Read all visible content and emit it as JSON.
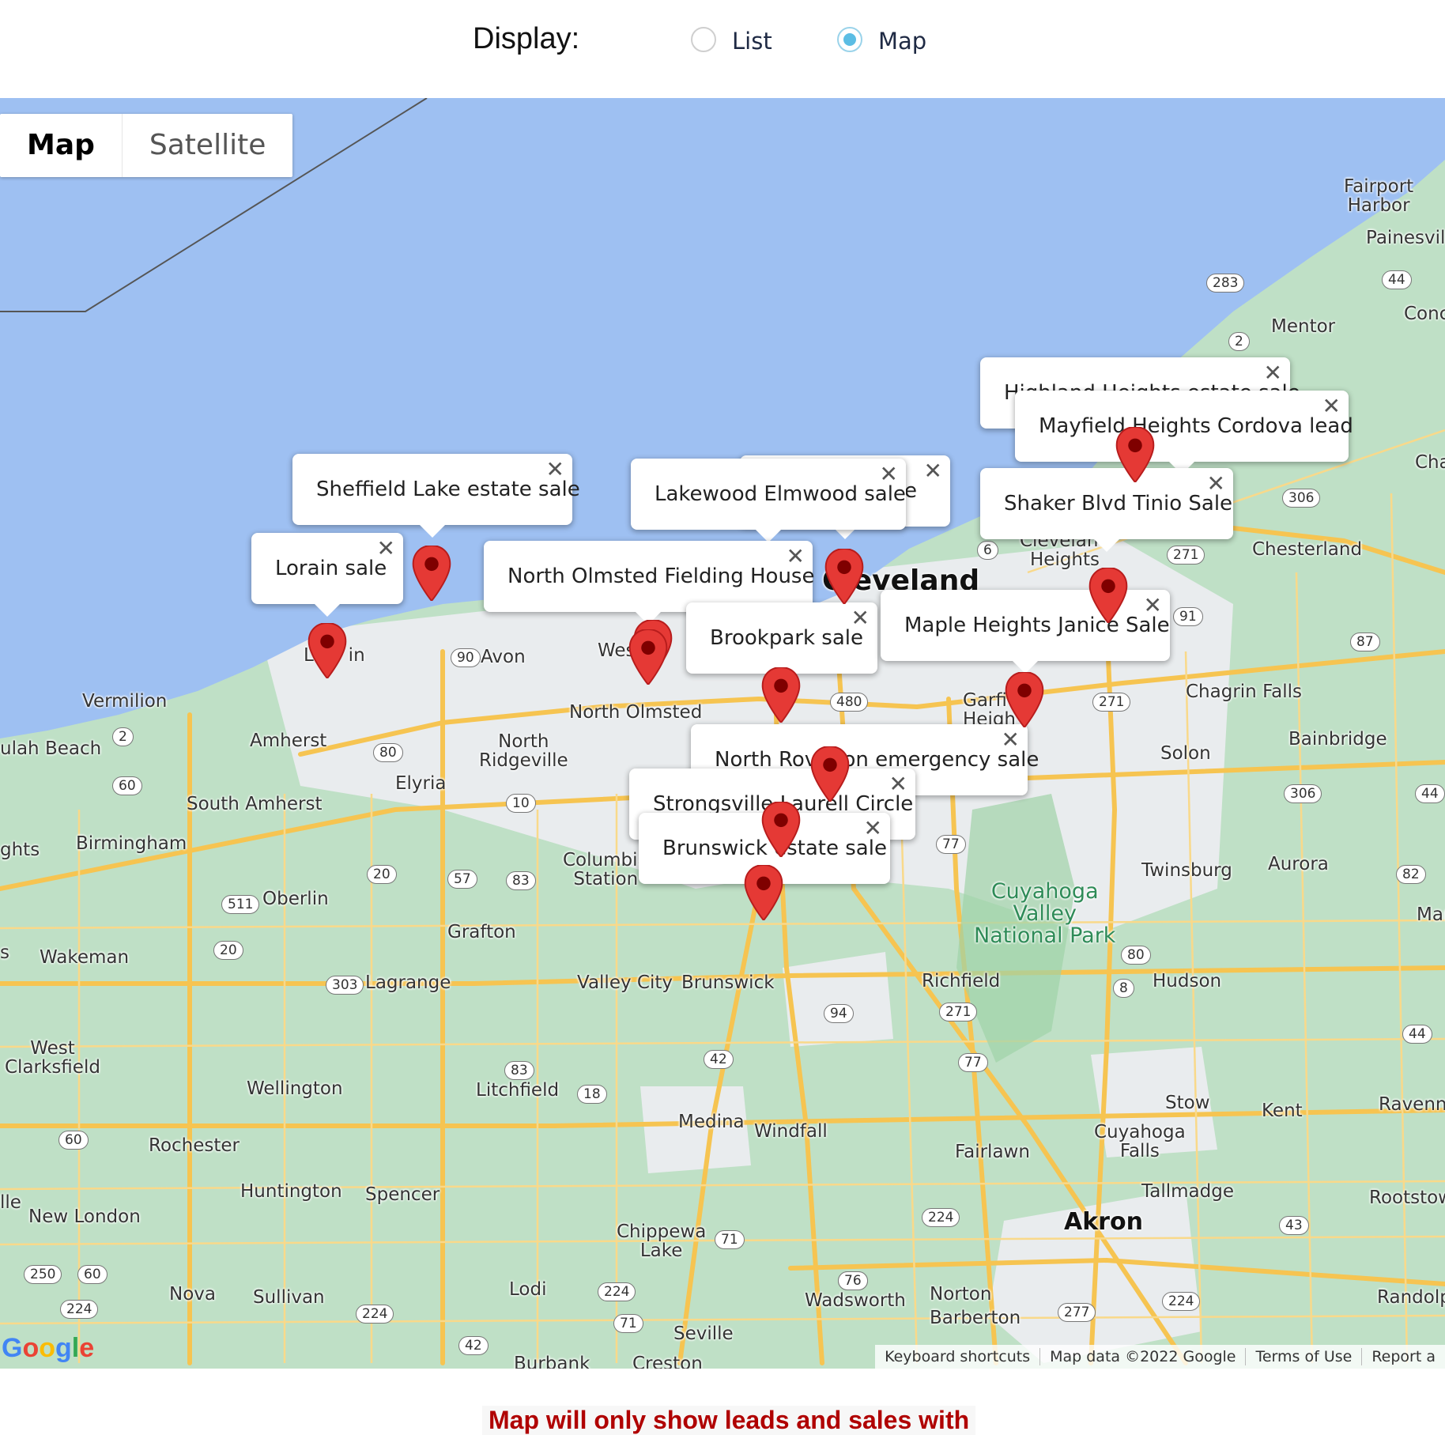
{
  "display": {
    "label": "Display:",
    "options": [
      {
        "label": "List",
        "checked": false
      },
      {
        "label": "Map",
        "checked": true
      }
    ]
  },
  "map": {
    "type_controls": {
      "map": "Map",
      "satellite": "Satellite"
    },
    "cities": {
      "cleveland": "Cleveland",
      "akron": "Akron",
      "avon": "Avon",
      "north_olmsted": "North Olmsted",
      "north_ridgeville": "North\nRidgeville",
      "elyria": "Elyria",
      "amherst": "Amherst",
      "south_amherst": "South Amherst",
      "vermilion": "Vermilion",
      "beach": "ulah Beach",
      "birmingham": "Birmingham",
      "heights_left": "ghts",
      "oberlin": "Oberlin",
      "wakeman": "Wakeman",
      "west_clarksfield": "West\nClarksfield",
      "lagrange": "Lagrange",
      "grafton": "Grafton",
      "columbia_station": "Columbia\nStation",
      "valley_city": "Valley City",
      "brunswick": "Brunswick",
      "wellington": "Wellington",
      "litchfield": "Litchfield",
      "medina": "Medina",
      "windfall": "Windfall",
      "rochester": "Rochester",
      "huntington": "Huntington",
      "spencer": "Spencer",
      "new_london": "New London",
      "chippewa_lake": "Chippewa\nLake",
      "lodi": "Lodi",
      "seville": "Seville",
      "nova": "Nova",
      "sullivan": "Sullivan",
      "wadsworth": "Wadsworth",
      "norton": "Norton",
      "barberton": "Barberton",
      "burbank": "Burbank",
      "creston": "Creston",
      "richfield": "Richfield",
      "hudson": "Hudson",
      "twinsburg": "Twinsburg",
      "aurora": "Aurora",
      "solon": "Solon",
      "bainbridge": "Bainbridge",
      "chagrin_falls": "Chagrin Falls",
      "chesterland": "Chesterland",
      "mentor": "Mentor",
      "fairport_harbor": "Fairport\nHarbor",
      "painesville": "Painesvill",
      "concord": "Conc",
      "chardon": "Cha",
      "cleveland_heights": "Cleveland\nHeights",
      "garfield_heights": "Garfi\nHeigh",
      "stow": "Stow",
      "kent": "Kent",
      "ravenna": "Ravenna",
      "cuyahoga_falls": "Cuyahoga\nFalls",
      "fairlawn": "Fairlawn",
      "tallmadge": "Tallmadge",
      "rootstown": "Rootstow",
      "randolph": "Randolph",
      "mantua": "Mant",
      "le_left": "lle",
      "s_left": "s",
      "west_left": "Wes",
      "lorain_partial": "L      in"
    },
    "park_label": "Cuyahoga\nValley\nNational Park",
    "shields": [
      "283",
      "44",
      "2",
      "6",
      "306",
      "271",
      "91",
      "87",
      "90",
      "480",
      "271",
      "2",
      "80",
      "60",
      "10",
      "77",
      "306",
      "44",
      "20",
      "57",
      "83",
      "82",
      "511",
      "20",
      "80",
      "303",
      "8",
      "271",
      "94",
      "42",
      "83",
      "18",
      "77",
      "44",
      "60",
      "71",
      "224",
      "43",
      "76",
      "250",
      "60",
      "224",
      "224",
      "224",
      "76",
      "277",
      "71",
      "224",
      "42"
    ],
    "markers": [
      {
        "label": "Lorain sale"
      },
      {
        "label": "Sheffield Lake estate sale"
      },
      {
        "label": "North Olmsted Fielding House"
      },
      {
        "label": "Lakewood Elmwood sale"
      },
      {
        "label": "Brookpark sale"
      },
      {
        "label": "Highland Heights estate sale"
      },
      {
        "label": "Mayfield Heights Cordova lead"
      },
      {
        "label": "Shaker Blvd Tinio Sale"
      },
      {
        "label": "Maple Heights Janice Sale"
      },
      {
        "label": "North Rovalton emergency sale"
      },
      {
        "label": "Strongsville Laurell Circle"
      },
      {
        "label": "Brunswick estate sale"
      }
    ],
    "partial_popup_suffix": "e",
    "attribution": [
      "Keyboard shortcuts",
      "Map data ©2022 Google",
      "Terms of Use",
      "Report a"
    ],
    "google_logo": "Google",
    "colors": {
      "water": "#9ec0f2",
      "land": "#bfe0c6",
      "urban": "#eceff1",
      "road": "#f6c451",
      "marker": "#e53935"
    }
  },
  "notice": "Map will only show leads and sales with"
}
